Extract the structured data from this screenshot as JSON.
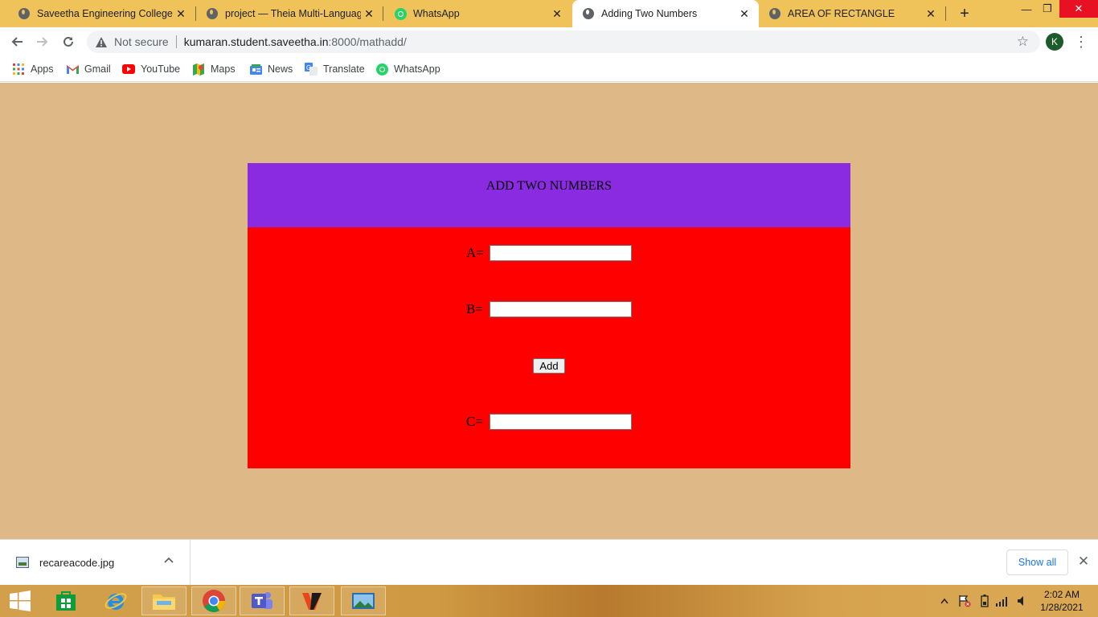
{
  "browser": {
    "tabs": [
      {
        "title": "Saveetha Engineering College",
        "icon": "globe-icon",
        "active": false
      },
      {
        "title": "project — Theia Multi-Language",
        "icon": "globe-icon",
        "active": false
      },
      {
        "title": "WhatsApp",
        "icon": "whatsapp-icon",
        "active": false
      },
      {
        "title": "Adding Two Numbers",
        "icon": "globe-icon",
        "active": true
      },
      {
        "title": "AREA OF RECTANGLE",
        "icon": "globe-icon",
        "active": false
      }
    ],
    "address": {
      "security": "Not secure",
      "host": "kumaran.student.saveetha.in",
      "path": ":8000/mathadd/"
    },
    "profile_initial": "K",
    "bookmarks": [
      {
        "label": "Apps",
        "icon": "apps-grid-icon"
      },
      {
        "label": "Gmail",
        "icon": "gmail-icon"
      },
      {
        "label": "YouTube",
        "icon": "youtube-icon"
      },
      {
        "label": "Maps",
        "icon": "maps-icon"
      },
      {
        "label": "News",
        "icon": "news-icon"
      },
      {
        "label": "Translate",
        "icon": "translate-icon"
      },
      {
        "label": "WhatsApp",
        "icon": "whatsapp-icon"
      }
    ]
  },
  "page": {
    "heading": "ADD TWO NUMBERS",
    "fields": [
      {
        "label": "A=",
        "value": ""
      },
      {
        "label": "B=",
        "value": ""
      },
      {
        "label": "C=",
        "value": ""
      }
    ],
    "add_button": "Add",
    "colors": {
      "background": "#deb887",
      "header": "#8a2be2",
      "body": "#ff0000"
    }
  },
  "downloads": {
    "file_name": "recareacode.jpg",
    "show_all": "Show all"
  },
  "taskbar": {
    "time": "2:02 AM",
    "date": "1/28/2021"
  }
}
